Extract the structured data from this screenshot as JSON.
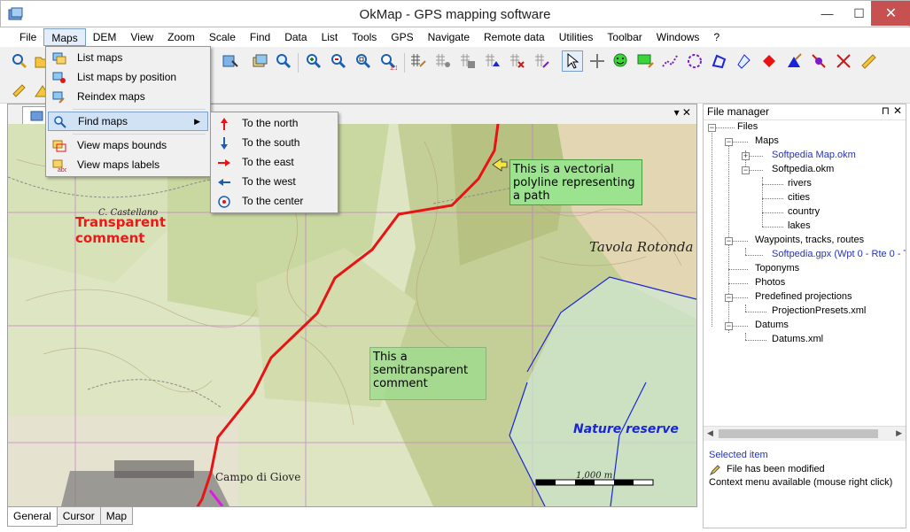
{
  "window": {
    "title": "OkMap - GPS mapping software",
    "minimize": "—",
    "maximize": "☐",
    "close": "✕"
  },
  "menubar": [
    "File",
    "Maps",
    "DEM",
    "View",
    "Zoom",
    "Scale",
    "Find",
    "Data",
    "List",
    "Tools",
    "GPS",
    "Navigate",
    "Remote data",
    "Utilities",
    "Toolbar",
    "Windows",
    "?"
  ],
  "maps_menu": {
    "items": [
      {
        "label": "List maps",
        "icon": "list-maps-icon"
      },
      {
        "label": "List maps by position",
        "icon": "list-maps-position-icon"
      },
      {
        "label": "Reindex maps",
        "icon": "reindex-icon"
      },
      {
        "label": "Find maps",
        "icon": "find-maps-icon",
        "submenu": "▶"
      },
      {
        "label": "View maps bounds",
        "icon": "maps-bounds-icon"
      },
      {
        "label": "View maps labels",
        "icon": "maps-labels-icon"
      }
    ]
  },
  "find_menu": {
    "items": [
      {
        "label": "To the north",
        "icon": "arrow-north-icon"
      },
      {
        "label": "To the south",
        "icon": "arrow-south-icon"
      },
      {
        "label": "To the east",
        "icon": "arrow-east-icon"
      },
      {
        "label": "To the west",
        "icon": "arrow-west-icon"
      },
      {
        "label": "To the center",
        "icon": "target-center-icon"
      }
    ]
  },
  "map": {
    "tab_tools": "▾  ✕",
    "comments": {
      "transparent": "Transparent comment",
      "semitransparent": "This a semitransparent comment",
      "vectorial": "This is a vectorial polyline representing a path",
      "nature": "Nature reserve"
    },
    "toponyms": {
      "tavola": "Tavola Rotonda",
      "campo": "Campo di Giove",
      "castellano": "C. Castellano",
      "scale": "1,000 m"
    },
    "path_color": "#e81414",
    "reserve_color": "#1a26d6"
  },
  "bottom_tabs": [
    "General",
    "Cursor",
    "Map"
  ],
  "file_manager": {
    "title": "File manager",
    "pin": "⊓",
    "close": "✕",
    "tree": [
      {
        "label": "Files",
        "link": false
      },
      {
        "label": "Maps",
        "link": false
      },
      {
        "label": "Softpedia Map.okm",
        "link": true
      },
      {
        "label": "Softpedia.okm",
        "link": false
      },
      {
        "label": "rivers",
        "link": false
      },
      {
        "label": "cities",
        "link": false
      },
      {
        "label": "country",
        "link": false
      },
      {
        "label": "lakes",
        "link": false
      },
      {
        "label": "Waypoints, tracks, routes",
        "link": false
      },
      {
        "label": "Softpedia.gpx (Wpt 0 - Rte 0 - T",
        "link": true
      },
      {
        "label": "Toponyms",
        "link": false
      },
      {
        "label": "Photos",
        "link": false
      },
      {
        "label": "Predefined projections",
        "link": false
      },
      {
        "label": "ProjectionPresets.xml",
        "link": false
      },
      {
        "label": "Datums",
        "link": false
      },
      {
        "label": "Datums.xml",
        "link": false
      }
    ],
    "info": {
      "selected": "Selected item",
      "modified": "File has been modified",
      "context": "Context menu available (mouse right click)"
    }
  }
}
